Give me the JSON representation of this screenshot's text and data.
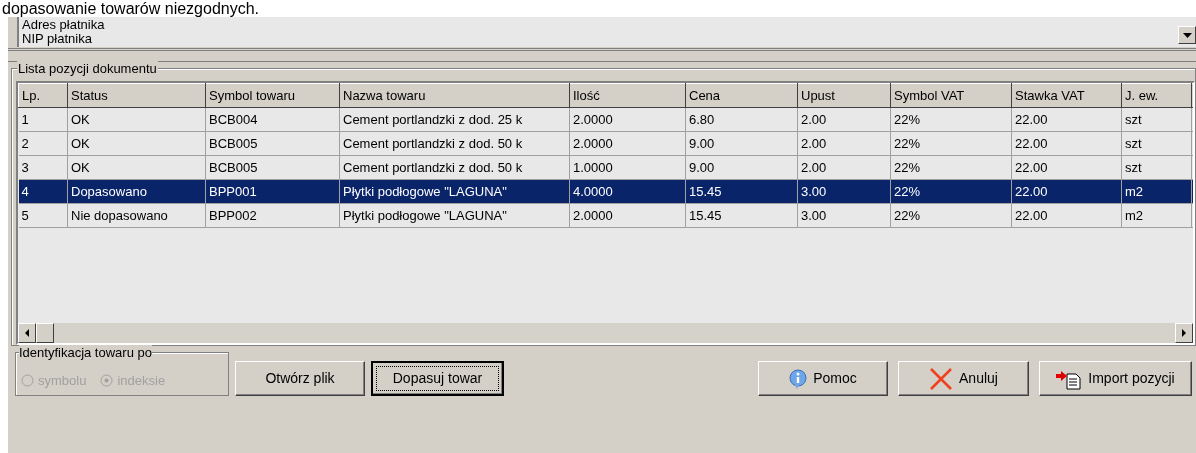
{
  "caption": "dopasowanie towarów niezgodnych.",
  "payer_fields": [
    "Adres płatnika",
    "NIP płatnika"
  ],
  "group": {
    "title": "Lista pozycji dokumentu"
  },
  "table": {
    "columns": [
      "Lp.",
      "Status",
      "Symbol towaru",
      "Nazwa towaru",
      "Ilość",
      "Cena",
      "Upust",
      "Symbol VAT",
      "Stawka VAT",
      "J. ew."
    ],
    "rows": [
      {
        "cells": [
          "1",
          "OK",
          "BCB004",
          "Cement portlandzki z dod. 25 k",
          "2.0000",
          "6.80",
          "2.00",
          "22%",
          "22.00",
          "szt"
        ],
        "selected": false
      },
      {
        "cells": [
          "2",
          "OK",
          "BCB005",
          "Cement portlandzki z dod. 50 k",
          "2.0000",
          "9.00",
          "2.00",
          "22%",
          "22.00",
          "szt"
        ],
        "selected": false
      },
      {
        "cells": [
          "3",
          "OK",
          "BCB005",
          "Cement portlandzki z dod. 50 k",
          "1.0000",
          "9.00",
          "2.00",
          "22%",
          "22.00",
          "szt"
        ],
        "selected": false
      },
      {
        "cells": [
          "4",
          "Dopasowano",
          "BPP001",
          "Płytki podłogowe \"LAGUNA\"",
          "4.0000",
          "15.45",
          "3.00",
          "22%",
          "22.00",
          "m2"
        ],
        "selected": true
      },
      {
        "cells": [
          "5",
          "Nie dopasowano",
          "BPP002",
          "Płytki podłogowe \"LAGUNA\"",
          "2.0000",
          "15.45",
          "3.00",
          "22%",
          "22.00",
          "m2"
        ],
        "selected": false
      }
    ]
  },
  "identification": {
    "title": "Identyfikacja towaru po",
    "disabled": true,
    "options": [
      {
        "label": "symbolu",
        "selected": false
      },
      {
        "label": "indeksie",
        "selected": true
      }
    ]
  },
  "buttons": [
    {
      "label": "Otwórz plik",
      "kind": "plain",
      "focused": false
    },
    {
      "label": "Dopasuj towar",
      "kind": "plain",
      "focused": true
    },
    {
      "label": "Pomoc",
      "kind": "help",
      "focused": false
    },
    {
      "label": "Anuluj",
      "kind": "cancel",
      "focused": false
    },
    {
      "label": "Import pozycji",
      "kind": "import",
      "focused": false
    }
  ]
}
